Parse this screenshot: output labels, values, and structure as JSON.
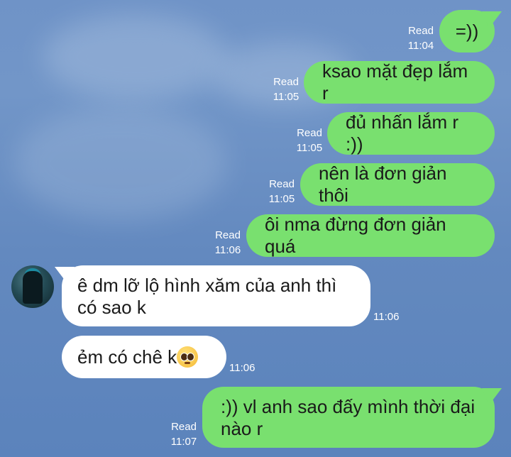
{
  "messages": [
    {
      "side": "out",
      "text": "=))",
      "status": "Read",
      "time": "11:04"
    },
    {
      "side": "out",
      "text": "ksao mặt đẹp lắm r",
      "status": "Read",
      "time": "11:05"
    },
    {
      "side": "out",
      "text": "đủ nhấn lắm r :))",
      "status": "Read",
      "time": "11:05"
    },
    {
      "side": "out",
      "text": "nên là đơn giản thôi",
      "status": "Read",
      "time": "11:05"
    },
    {
      "side": "out",
      "text": "ôi nma đừng đơn giản quá",
      "status": "Read",
      "time": "11:06"
    },
    {
      "side": "in",
      "text_line1": "ê dm lỡ lộ hình xăm của anh thì",
      "text_line2": "có sao k",
      "time": "11:06"
    },
    {
      "side": "in",
      "text": "ẻm có chê k",
      "emoji": "pleading-face-emoji",
      "time": "11:06"
    },
    {
      "side": "out",
      "text_line1": ":)) vl anh sao đấy mình thời đại",
      "text_line2": "nào r",
      "status": "Read",
      "time": "11:07"
    }
  ],
  "colors": {
    "outgoing_bubble": "#79e06f",
    "incoming_bubble": "#ffffff",
    "background": "#6f93c7"
  }
}
